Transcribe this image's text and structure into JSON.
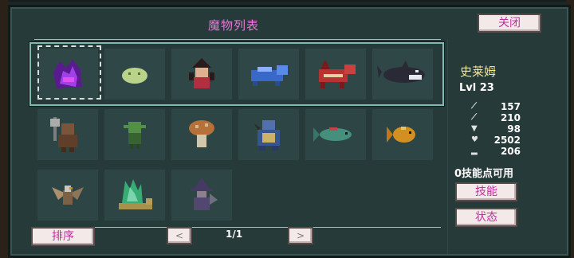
{
  "panel": {
    "title": "魔物列表",
    "close_label": "关闭"
  },
  "monsters": [
    {
      "name": "dark-crystal-beast",
      "color": "#8a3fd0"
    },
    {
      "name": "slime",
      "color": "#b9d38a"
    },
    {
      "name": "red-witch",
      "color": "#b03040"
    },
    {
      "name": "blue-wolf",
      "color": "#3a68c8"
    },
    {
      "name": "red-dragon",
      "color": "#b83232"
    },
    {
      "name": "orca",
      "color": "#2a2a36"
    },
    {
      "name": "minotaur-axe",
      "color": "#8a5a3a"
    },
    {
      "name": "goblin",
      "color": "#5aa04a"
    },
    {
      "name": "mushroom",
      "color": "#d07a3a"
    },
    {
      "name": "turtle",
      "color": "#3a5aa0"
    },
    {
      "name": "green-fish",
      "color": "#4aa08a"
    },
    {
      "name": "gold-fish",
      "color": "#f0a020"
    },
    {
      "name": "eagle",
      "color": "#c0a078"
    },
    {
      "name": "crystal-snail",
      "color": "#3ac080"
    },
    {
      "name": "witch",
      "color": "#5a4a7a"
    }
  ],
  "info": {
    "name": "史莱姆",
    "level": "Lvl 23",
    "stats": [
      {
        "icon": "sword-icon",
        "value": "157"
      },
      {
        "icon": "staff-icon",
        "value": "210"
      },
      {
        "icon": "shield-icon",
        "value": "98"
      },
      {
        "icon": "heart-icon",
        "value": "2502"
      },
      {
        "icon": "boot-icon",
        "value": "206"
      }
    ],
    "skill_points": "0技能点可用",
    "skill_label": "技能",
    "status_label": "状态"
  },
  "pager": {
    "sort_label": "排序",
    "prev_label": "<",
    "next_label": ">",
    "page": "1/1"
  }
}
